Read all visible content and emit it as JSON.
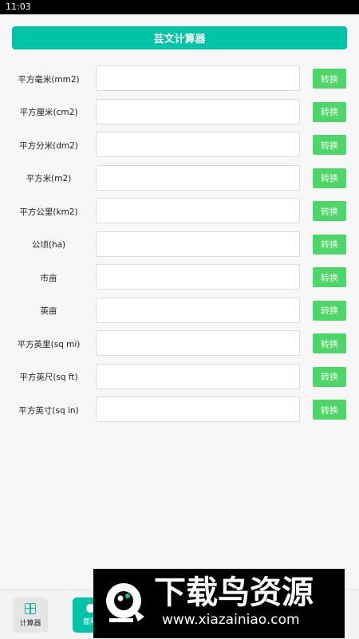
{
  "status_bar": {
    "time": "11:03"
  },
  "header": {
    "title": "芸文计算器"
  },
  "rows": [
    {
      "label": "平方毫米(mm2)",
      "value": "",
      "button": "转换"
    },
    {
      "label": "平方厘米(cm2)",
      "value": "",
      "button": "转换"
    },
    {
      "label": "平方分米(dm2)",
      "value": "",
      "button": "转换"
    },
    {
      "label": "平方米(m2)",
      "value": "",
      "button": "转换"
    },
    {
      "label": "平方公里(km2)",
      "value": "",
      "button": "转换"
    },
    {
      "label": "公顷(ha)",
      "value": "",
      "button": "转换"
    },
    {
      "label": "市亩",
      "value": "",
      "button": "转换"
    },
    {
      "label": "英亩",
      "value": "",
      "button": "转换"
    },
    {
      "label": "平方英里(sq mi)",
      "value": "",
      "button": "转换"
    },
    {
      "label": "平方英尺(sq ft)",
      "value": "",
      "button": "转换"
    },
    {
      "label": "平方英寸(sq in)",
      "value": "",
      "button": "转换"
    }
  ],
  "bottom_nav": {
    "items": [
      {
        "label": "计算器",
        "icon": "calculator-icon",
        "active": false
      },
      {
        "label": "面积",
        "icon": "dot-icon",
        "active": true
      }
    ]
  },
  "watermark": {
    "title": "下载鸟资源",
    "url": "www.xiazainiao.com"
  },
  "colors": {
    "accent": "#00c4a7",
    "button": "#4cd768",
    "status_bar": "#000000",
    "background": "#f7f7f7"
  }
}
